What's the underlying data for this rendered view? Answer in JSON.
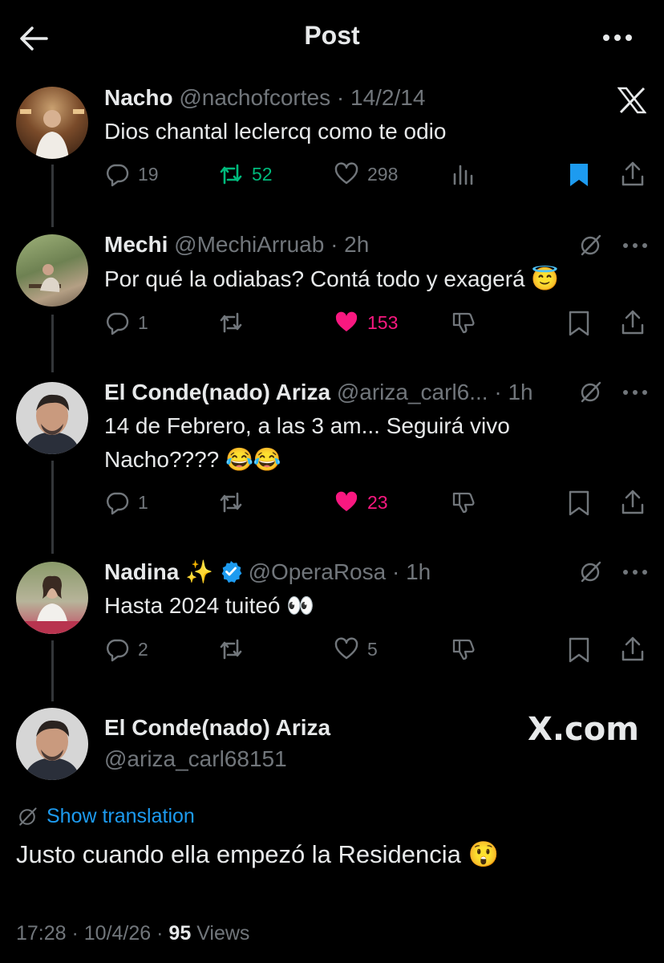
{
  "header": {
    "title": "Post"
  },
  "tweets": [
    {
      "name": "Nacho",
      "handle": "@nachofcortes",
      "time": "· 14/2/14",
      "text": "Dios chantal leclercq como te odio",
      "reply": "19",
      "retweet": "52",
      "like": "298"
    },
    {
      "name": "Mechi",
      "handle": "@MechiArruab",
      "time": "· 2h",
      "text": "Por qué la odiabas? Contá todo y exagerá 😇",
      "reply": "1",
      "like": "153"
    },
    {
      "name": "El Conde(nado) Ariza",
      "handle": "@ariza_carl6...",
      "time": "· 1h",
      "text1": "14 de Febrero, a las 3 am... Seguirá vivo",
      "text2": "Nacho???? 😂😂",
      "reply": "1",
      "like": "23"
    },
    {
      "name": "Nadina",
      "name_emoji": "✨",
      "handle": "@OperaRosa",
      "time": "· 1h",
      "text": "Hasta 2024 tuiteó 👀",
      "reply": "2",
      "like": "5"
    }
  ],
  "main": {
    "name": "El Conde(nado) Ariza",
    "handle": "@ariza_carl68151",
    "watermark": "X.com",
    "show_translation": "Show translation",
    "text": "Justo cuando ella empezó la Residencia 😲",
    "time": "17:28 · 10/4/26 ·",
    "views_count": "95",
    "views_label": "Views"
  },
  "colors": {
    "like": "#f91880",
    "retweet": "#00ba7c",
    "bookmark": "#1d9bf0",
    "verified": "#1d9bf0",
    "muted": "#71767b"
  }
}
